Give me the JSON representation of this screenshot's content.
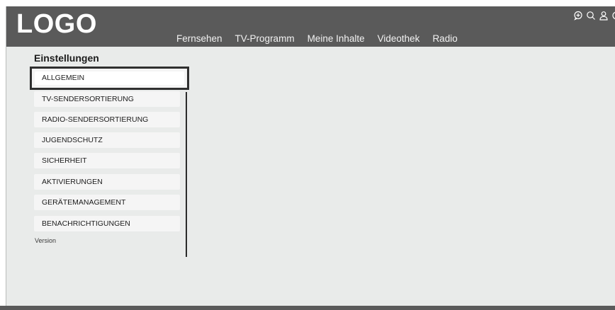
{
  "header": {
    "logo": "LOGO",
    "nav": [
      "Fernsehen",
      "TV-Programm",
      "Meine Inhalte",
      "Videothek",
      "Radio"
    ],
    "icons": [
      "add-chat-icon",
      "search-icon",
      "user-icon",
      "settings-icon"
    ]
  },
  "settings": {
    "title": "Einstellungen",
    "items": [
      "ALLGEMEIN",
      "TV-SENDERSORTIERUNG",
      "RADIO-SENDERSORTIERUNG",
      "JUGENDSCHUTZ",
      "SICHERHEIT",
      "AKTIVIERUNGEN",
      "GERÄTEMANAGEMENT",
      "BENACHRICHTIGUNGEN"
    ],
    "selected": "ALLGEMEIN",
    "version_label": "Version"
  },
  "colors": {
    "header_bg": "#5a5a5a",
    "content_bg": "#e9ebea",
    "menu_item_bg": "#f5f5f5",
    "focus_border": "#2f2f2f"
  }
}
